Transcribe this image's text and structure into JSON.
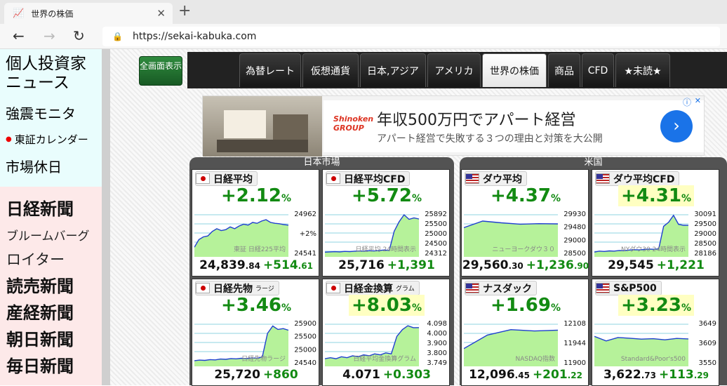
{
  "browser": {
    "tab_title": "世界の株価",
    "tab_close": "✕",
    "new_tab": "+",
    "url": "https://sekai-kabuka.com"
  },
  "sidebar": {
    "links": [
      "個人投資家ニュース",
      "強震モニタ",
      "東証カレンダー",
      "市場休日"
    ],
    "news": [
      "日経新聞",
      "ブルームバーグ",
      "ロイター",
      "読売新聞",
      "産経新聞",
      "朝日新聞",
      "毎日新聞"
    ]
  },
  "toolbar": {
    "fullscreen_label": "全画面表示",
    "nav": [
      "為替レート",
      "仮想通貨",
      "日本,アジア",
      "アメリカ",
      "世界の株価",
      "商品",
      "CFD",
      "★未読★"
    ],
    "active_index": 4
  },
  "ad": {
    "logo": "Shinoken GROUP",
    "title": "年収500万円でアパート経営",
    "subtitle": "アパート経営で失敗する３つの理由と対策を大公開"
  },
  "sections": {
    "japan": "日本市場",
    "us": "米国"
  },
  "colors": {
    "up": "#128a12",
    "area": "#b6f29a",
    "line": "#1f3fd0",
    "highlight": "#ffffc2"
  },
  "cards": [
    {
      "name": "日経平均",
      "flag": "jp",
      "pct": "+2.12",
      "pct_unit": "%",
      "price_main": "24,839",
      "price_dec": ".84",
      "chg_main": "+514",
      "chg_dec": ".61",
      "chart_label": "東証 日経225平均",
      "y_labels": [
        "24962",
        "+2%",
        "24541"
      ],
      "highlight": false,
      "chart_data": {
        "type": "line",
        "ylim": [
          24200,
          25100
        ],
        "values": [
          24350,
          24520,
          24580,
          24600,
          24700,
          24760,
          24720,
          24740,
          24800,
          24760,
          24820,
          24860,
          24840,
          24900,
          24880,
          24930,
          24960,
          24900,
          24880,
          24870,
          24850,
          24839
        ]
      }
    },
    {
      "name": "日経平均CFD",
      "flag": "jp",
      "pct": "+5.72",
      "pct_unit": "%",
      "price_main": "25,716",
      "price_dec": "",
      "chg_main": "+1,391",
      "chg_dec": "",
      "chart_label": "日経平均 24時間表示",
      "y_labels": [
        "25892",
        "25500",
        "25000",
        "24500",
        "24312"
      ],
      "highlight": false,
      "chart_data": {
        "type": "line",
        "ylim": [
          24250,
          25950
        ],
        "values": [
          24330,
          24340,
          24350,
          24340,
          24360,
          24350,
          24370,
          24380,
          24370,
          24390,
          24380,
          24400,
          24420,
          24400,
          25200,
          25600,
          25890,
          25700,
          25760,
          25716
        ]
      }
    },
    {
      "name": "ダウ平均",
      "flag": "us",
      "pct": "+4.37",
      "pct_unit": "%",
      "price_main": "29,560",
      "price_dec": ".30",
      "chg_main": "+1,236",
      "chg_dec": ".90",
      "chart_label": "ニューヨークダウ３０",
      "y_labels": [
        "29930",
        "29480",
        "29000",
        "28500"
      ],
      "highlight": false,
      "chart_data": {
        "type": "line",
        "ylim": [
          28200,
          30050
        ],
        "values": [
          29400,
          29700,
          29620,
          29560,
          29580,
          29570
        ]
      }
    },
    {
      "name": "ダウ平均CFD",
      "flag": "us",
      "pct": "+4.31",
      "pct_unit": "%",
      "price_main": "29,545",
      "price_dec": "",
      "chg_main": "+1,221",
      "chg_dec": "",
      "chart_label": "NYダウ30 24時間表示",
      "y_labels": [
        "30091",
        "29500",
        "29000",
        "28500",
        "28186"
      ],
      "highlight": true,
      "chart_data": {
        "type": "line",
        "ylim": [
          28100,
          30150
        ],
        "values": [
          28200,
          28250,
          28230,
          28260,
          28250,
          28280,
          28270,
          28300,
          28320,
          28310,
          28330,
          28350,
          28340,
          28360,
          29500,
          29700,
          30050,
          29600,
          29550,
          29545
        ]
      }
    },
    {
      "name": "日経先物",
      "name_sub": "ラージ",
      "flag": "jp",
      "pct": "+3.46",
      "pct_unit": "%",
      "price_main": "25,720",
      "price_dec": "",
      "chg_main": "+860",
      "chg_dec": "",
      "chart_label": "日経先物ラージ",
      "y_labels": [
        "25900",
        "25500",
        "25000",
        "24540"
      ],
      "highlight": false,
      "chart_data": {
        "type": "line",
        "ylim": [
          24450,
          26000
        ],
        "values": [
          24560,
          24580,
          24570,
          24600,
          24590,
          24620,
          24610,
          24640,
          24630,
          24650,
          24640,
          24660,
          24650,
          24700,
          25600,
          25880,
          25750,
          25780,
          25720
        ]
      }
    },
    {
      "name": "日経金換算",
      "name_sub": "グラム",
      "flag": "jp",
      "pct": "+8.03",
      "pct_unit": "%",
      "price_main": "4.071",
      "price_dec": "",
      "chg_main": "+0.303",
      "chg_dec": "",
      "chart_label": "日経平均金換算グラム",
      "y_labels": [
        "4.098",
        "4.000",
        "3.900",
        "3.800",
        "3.749"
      ],
      "highlight": true,
      "chart_data": {
        "type": "line",
        "ylim": [
          3.7,
          4.12
        ],
        "values": [
          3.75,
          3.76,
          3.75,
          3.77,
          3.76,
          3.78,
          3.77,
          3.79,
          3.78,
          3.8,
          3.79,
          3.81,
          3.8,
          3.98,
          4.05,
          4.09,
          4.07,
          4.071
        ]
      }
    },
    {
      "name": "ナスダック",
      "flag": "us",
      "pct": "+1.69",
      "pct_unit": "%",
      "price_main": "12,096",
      "price_dec": ".45",
      "chg_main": "+201",
      "chg_dec": ".22",
      "chart_label": "NASDAQ指数",
      "y_labels": [
        "12108",
        "11944",
        "11900"
      ],
      "highlight": false,
      "chart_data": {
        "type": "line",
        "ylim": [
          11850,
          12150
        ],
        "values": [
          11960,
          12060,
          12100,
          12090,
          12096
        ]
      }
    },
    {
      "name": "S&P500",
      "flag": "us",
      "pct": "+3.23",
      "pct_unit": "%",
      "price_main": "3,622",
      "price_dec": ".73",
      "chg_main": "+113",
      "chg_dec": ".29",
      "chart_label": "Standard&Poor's500",
      "y_labels": [
        "3649",
        "3609",
        "3550"
      ],
      "highlight": true,
      "chart_data": {
        "type": "line",
        "ylim": [
          3500,
          3680
        ],
        "values": [
          3620,
          3600,
          3615,
          3612,
          3608,
          3610,
          3605,
          3611,
          3609
        ]
      }
    }
  ]
}
